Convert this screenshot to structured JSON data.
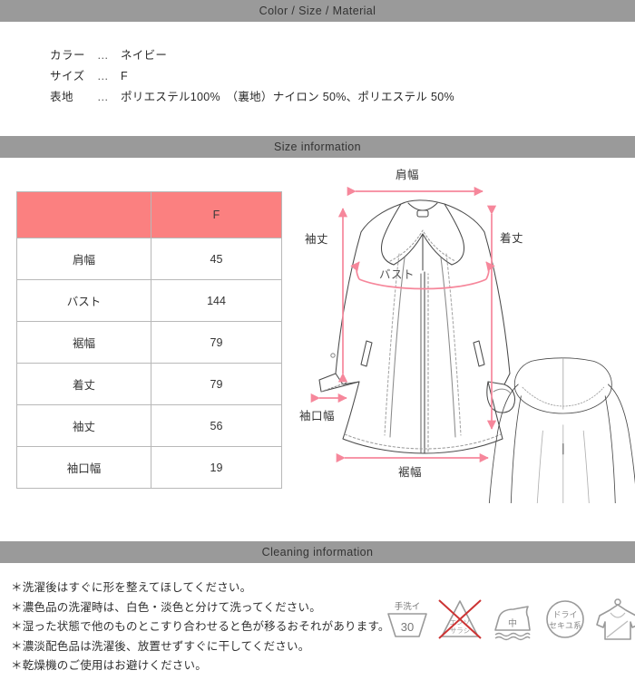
{
  "sections": {
    "color_size_material": "Color / Size / Material",
    "size_information": "Size information",
    "cleaning_information": "Cleaning information"
  },
  "product_info": [
    {
      "key": "カラー",
      "dots": "…",
      "value": "ネイビー"
    },
    {
      "key": "サイズ",
      "dots": "…",
      "value": "F"
    },
    {
      "key": "表地",
      "dots": "…",
      "value": "ポリエステル100%　（裏地）ナイロン 50%、ポリエステル 50%"
    }
  ],
  "size_table": {
    "header": [
      "",
      "F"
    ],
    "rows": [
      {
        "label": "肩幅",
        "F": "45"
      },
      {
        "label": "バスト",
        "F": "144"
      },
      {
        "label": "裾幅",
        "F": "79"
      },
      {
        "label": "着丈",
        "F": "79"
      },
      {
        "label": "袖丈",
        "F": "56"
      },
      {
        "label": "袖口幅",
        "F": "19"
      }
    ]
  },
  "diagram": {
    "labels": {
      "shoulder_width": "肩幅",
      "sleeve_length": "袖丈",
      "body_length": "着丈",
      "bust": "バスト",
      "cuff_width": "袖口幅",
      "hem_width": "裾幅"
    }
  },
  "cleaning_notes": [
    "＊洗濯後はすぐに形を整えてほしてください。",
    "＊濃色品の洗濯時は、白色・淡色と分けて洗ってください。",
    "＊湿った状態で他のものとこすり合わせると色が移るおそれがあります。",
    "＊濃淡配色品は洗濯後、放置せずすぐに干してください。",
    "＊乾燥機のご使用はお避けください。"
  ],
  "care_symbols": [
    {
      "name": "hand-wash-icon",
      "top_text": "手洗イ",
      "inner_text": "30",
      "crossed": false
    },
    {
      "name": "no-bleach-icon",
      "top_text": "",
      "inner_text": "エンソサラシ",
      "crossed": true
    },
    {
      "name": "iron-medium-icon",
      "top_text": "",
      "inner_text": "中",
      "crossed": false
    },
    {
      "name": "dry-clean-icon",
      "top_text": "ドライ",
      "inner_text": "セキユ系",
      "crossed": false
    },
    {
      "name": "flat-dry-icon",
      "top_text": "",
      "inner_text": "",
      "crossed": false
    }
  ],
  "colors": {
    "bar_gray": "#9a9a9a",
    "table_header_pink": "#fb8080",
    "measure_arrow_pink": "#f6879b",
    "border_gray": "#b8b8b8",
    "cross_red": "#cc3333"
  }
}
